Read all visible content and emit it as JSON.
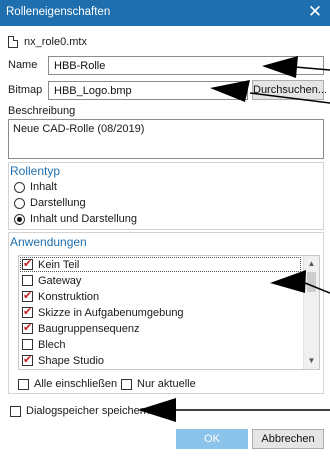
{
  "window": {
    "title": "Rolleneigenschaften",
    "close_glyph": "✕"
  },
  "file": {
    "name": "nx_role0.mtx"
  },
  "name_field": {
    "label": "Name",
    "value": "HBB-Rolle"
  },
  "bitmap_field": {
    "label": "Bitmap",
    "value": "HBB_Logo.bmp",
    "browse_label": "Durchsuchen..."
  },
  "description": {
    "label": "Beschreibung",
    "value": "Neue CAD-Rolle (08/2019)"
  },
  "role_type": {
    "title": "Rollentyp",
    "options": [
      {
        "label": "Inhalt",
        "selected": false
      },
      {
        "label": "Darstellung",
        "selected": false
      },
      {
        "label": "Inhalt und Darstellung",
        "selected": true
      }
    ]
  },
  "applications": {
    "title": "Anwendungen",
    "items": [
      {
        "label": "Kein Teil",
        "checked": true
      },
      {
        "label": "Gateway",
        "checked": false
      },
      {
        "label": "Konstruktion",
        "checked": true
      },
      {
        "label": "Skizze in Aufgabenumgebung",
        "checked": true
      },
      {
        "label": "Baugruppensequenz",
        "checked": true
      },
      {
        "label": "Blech",
        "checked": false
      },
      {
        "label": "Shape Studio",
        "checked": true
      }
    ],
    "include_all_label": "Alle einschließen",
    "only_current_label": "Nur aktuelle"
  },
  "save_dialog_memory": {
    "label": "Dialogspeicher speichern",
    "checked": false
  },
  "buttons": {
    "ok": "OK",
    "cancel": "Abbrechen"
  },
  "colors": {
    "titlebar": "#1f6fae",
    "group_title": "#1f6fae",
    "check": "#c41f1f",
    "ok_button": "#8cc3ea"
  }
}
